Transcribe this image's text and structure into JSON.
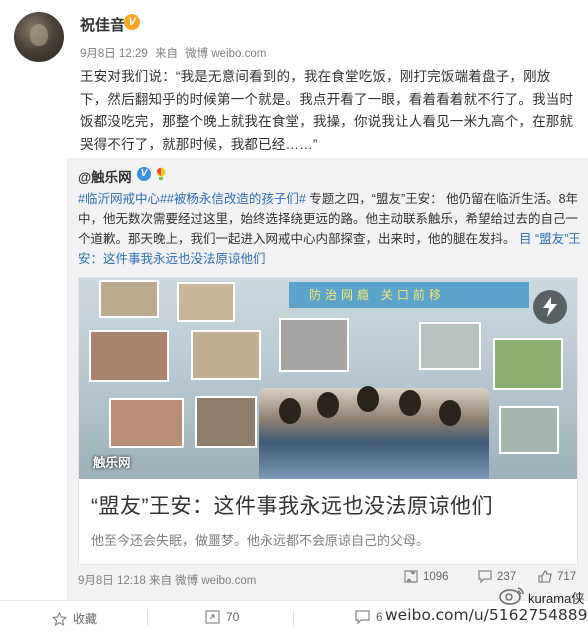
{
  "post": {
    "username": "祝佳音",
    "verified_badge": "V",
    "time": "9月8日 12:29",
    "source_prefix": "来自",
    "source": "微博 weibo.com",
    "text": "王安对我们说：“我是无意间看到的，我在食堂吃饭，刚打完饭端着盘子，刚放下，然后翻知乎的时候第一个就是。我点开看了一眼，看着看着就不行了。我当时饭都没吃完，那整个晚上就我在食堂，我操，你说我让人看见一米九高个，在那就哭得不行了，就那时候，我都已经……”"
  },
  "repost": {
    "author": "@触乐网",
    "verified_badge": "V",
    "tag1": "#临沂网戒中心#",
    "tag2": "#被杨永信改造的孩子们#",
    "text_main": " 专题之四，“盟友”王安： 他仍留在临沂生活。8年中，他无数次需要经过这里，始终选择绕更远的路。他主动联系触乐，希望给过去的自己一个道歉。那天晚上，我们一起进入网戒中心内部探查，出来时，他的腿在发抖。 ",
    "link_icon": "目",
    "link_text": "“盟友”王安：这件事我永远也没法原谅他们",
    "card": {
      "image_banner": "防治网瘾 关口前移",
      "image_watermark": "触乐网",
      "title": "“盟友”王安：这件事我永远也没法原谅他们",
      "description": "他至今还会失眠，做噩梦。他永远都不会原谅自己的父母。"
    },
    "time": "9月8日 12:18",
    "source_prefix": "来自",
    "source": "微博 weibo.com",
    "reposts": "1096",
    "comments": "237",
    "likes": "717"
  },
  "actions": {
    "favorite_label": "收藏",
    "repost_count": "70",
    "comment_count": "6"
  },
  "overlay": {
    "watermark_url": "weibo.com/u/5162754889",
    "watermark_name": "kurama侠"
  },
  "colors": {
    "link": "#2f6eb5",
    "badge_orange": "#f5a623",
    "badge_blue": "#3b8ee0",
    "repost_bg": "#f2f2f5"
  },
  "icons": [
    "star-icon",
    "repost-icon",
    "comment-icon",
    "like-icon",
    "flash-icon",
    "verified-icon",
    "bulb-icon"
  ]
}
